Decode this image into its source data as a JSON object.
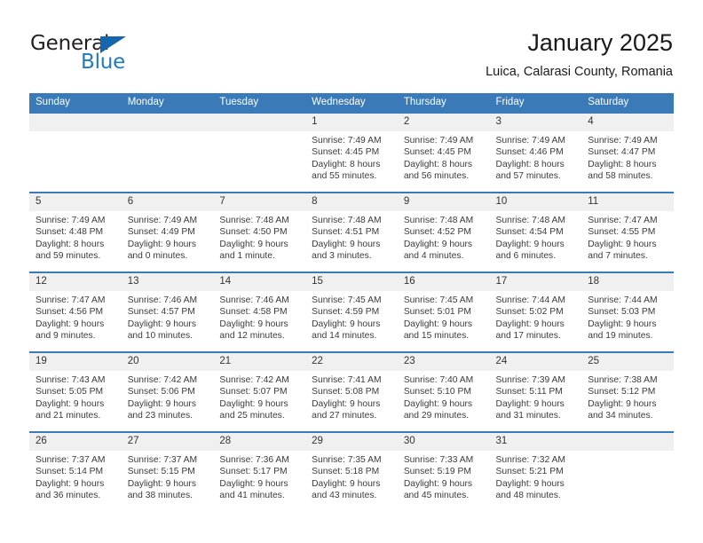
{
  "brand": {
    "name_part1": "General",
    "name_part2": "Blue",
    "triangle_color": "#1566ad",
    "blue_color": "#1f7bc1"
  },
  "header": {
    "title": "January 2025",
    "subtitle": "Luica, Calarasi County, Romania"
  },
  "theme": {
    "header_blue": "#3a7ab8",
    "daynum_bg": "#f0f0f0"
  },
  "weekday_headers": [
    "Sunday",
    "Monday",
    "Tuesday",
    "Wednesday",
    "Thursday",
    "Friday",
    "Saturday"
  ],
  "weeks": [
    [
      {
        "day": "",
        "blank": true,
        "sunrise": "",
        "sunset": "",
        "daylight": ""
      },
      {
        "day": "",
        "blank": true,
        "sunrise": "",
        "sunset": "",
        "daylight": ""
      },
      {
        "day": "",
        "blank": true,
        "sunrise": "",
        "sunset": "",
        "daylight": ""
      },
      {
        "day": "1",
        "blank": false,
        "sunrise": "Sunrise: 7:49 AM",
        "sunset": "Sunset: 4:45 PM",
        "daylight": "Daylight: 8 hours and 55 minutes."
      },
      {
        "day": "2",
        "blank": false,
        "sunrise": "Sunrise: 7:49 AM",
        "sunset": "Sunset: 4:45 PM",
        "daylight": "Daylight: 8 hours and 56 minutes."
      },
      {
        "day": "3",
        "blank": false,
        "sunrise": "Sunrise: 7:49 AM",
        "sunset": "Sunset: 4:46 PM",
        "daylight": "Daylight: 8 hours and 57 minutes."
      },
      {
        "day": "4",
        "blank": false,
        "sunrise": "Sunrise: 7:49 AM",
        "sunset": "Sunset: 4:47 PM",
        "daylight": "Daylight: 8 hours and 58 minutes."
      }
    ],
    [
      {
        "day": "5",
        "blank": false,
        "sunrise": "Sunrise: 7:49 AM",
        "sunset": "Sunset: 4:48 PM",
        "daylight": "Daylight: 8 hours and 59 minutes."
      },
      {
        "day": "6",
        "blank": false,
        "sunrise": "Sunrise: 7:49 AM",
        "sunset": "Sunset: 4:49 PM",
        "daylight": "Daylight: 9 hours and 0 minutes."
      },
      {
        "day": "7",
        "blank": false,
        "sunrise": "Sunrise: 7:48 AM",
        "sunset": "Sunset: 4:50 PM",
        "daylight": "Daylight: 9 hours and 1 minute."
      },
      {
        "day": "8",
        "blank": false,
        "sunrise": "Sunrise: 7:48 AM",
        "sunset": "Sunset: 4:51 PM",
        "daylight": "Daylight: 9 hours and 3 minutes."
      },
      {
        "day": "9",
        "blank": false,
        "sunrise": "Sunrise: 7:48 AM",
        "sunset": "Sunset: 4:52 PM",
        "daylight": "Daylight: 9 hours and 4 minutes."
      },
      {
        "day": "10",
        "blank": false,
        "sunrise": "Sunrise: 7:48 AM",
        "sunset": "Sunset: 4:54 PM",
        "daylight": "Daylight: 9 hours and 6 minutes."
      },
      {
        "day": "11",
        "blank": false,
        "sunrise": "Sunrise: 7:47 AM",
        "sunset": "Sunset: 4:55 PM",
        "daylight": "Daylight: 9 hours and 7 minutes."
      }
    ],
    [
      {
        "day": "12",
        "blank": false,
        "sunrise": "Sunrise: 7:47 AM",
        "sunset": "Sunset: 4:56 PM",
        "daylight": "Daylight: 9 hours and 9 minutes."
      },
      {
        "day": "13",
        "blank": false,
        "sunrise": "Sunrise: 7:46 AM",
        "sunset": "Sunset: 4:57 PM",
        "daylight": "Daylight: 9 hours and 10 minutes."
      },
      {
        "day": "14",
        "blank": false,
        "sunrise": "Sunrise: 7:46 AM",
        "sunset": "Sunset: 4:58 PM",
        "daylight": "Daylight: 9 hours and 12 minutes."
      },
      {
        "day": "15",
        "blank": false,
        "sunrise": "Sunrise: 7:45 AM",
        "sunset": "Sunset: 4:59 PM",
        "daylight": "Daylight: 9 hours and 14 minutes."
      },
      {
        "day": "16",
        "blank": false,
        "sunrise": "Sunrise: 7:45 AM",
        "sunset": "Sunset: 5:01 PM",
        "daylight": "Daylight: 9 hours and 15 minutes."
      },
      {
        "day": "17",
        "blank": false,
        "sunrise": "Sunrise: 7:44 AM",
        "sunset": "Sunset: 5:02 PM",
        "daylight": "Daylight: 9 hours and 17 minutes."
      },
      {
        "day": "18",
        "blank": false,
        "sunrise": "Sunrise: 7:44 AM",
        "sunset": "Sunset: 5:03 PM",
        "daylight": "Daylight: 9 hours and 19 minutes."
      }
    ],
    [
      {
        "day": "19",
        "blank": false,
        "sunrise": "Sunrise: 7:43 AM",
        "sunset": "Sunset: 5:05 PM",
        "daylight": "Daylight: 9 hours and 21 minutes."
      },
      {
        "day": "20",
        "blank": false,
        "sunrise": "Sunrise: 7:42 AM",
        "sunset": "Sunset: 5:06 PM",
        "daylight": "Daylight: 9 hours and 23 minutes."
      },
      {
        "day": "21",
        "blank": false,
        "sunrise": "Sunrise: 7:42 AM",
        "sunset": "Sunset: 5:07 PM",
        "daylight": "Daylight: 9 hours and 25 minutes."
      },
      {
        "day": "22",
        "blank": false,
        "sunrise": "Sunrise: 7:41 AM",
        "sunset": "Sunset: 5:08 PM",
        "daylight": "Daylight: 9 hours and 27 minutes."
      },
      {
        "day": "23",
        "blank": false,
        "sunrise": "Sunrise: 7:40 AM",
        "sunset": "Sunset: 5:10 PM",
        "daylight": "Daylight: 9 hours and 29 minutes."
      },
      {
        "day": "24",
        "blank": false,
        "sunrise": "Sunrise: 7:39 AM",
        "sunset": "Sunset: 5:11 PM",
        "daylight": "Daylight: 9 hours and 31 minutes."
      },
      {
        "day": "25",
        "blank": false,
        "sunrise": "Sunrise: 7:38 AM",
        "sunset": "Sunset: 5:12 PM",
        "daylight": "Daylight: 9 hours and 34 minutes."
      }
    ],
    [
      {
        "day": "26",
        "blank": false,
        "sunrise": "Sunrise: 7:37 AM",
        "sunset": "Sunset: 5:14 PM",
        "daylight": "Daylight: 9 hours and 36 minutes."
      },
      {
        "day": "27",
        "blank": false,
        "sunrise": "Sunrise: 7:37 AM",
        "sunset": "Sunset: 5:15 PM",
        "daylight": "Daylight: 9 hours and 38 minutes."
      },
      {
        "day": "28",
        "blank": false,
        "sunrise": "Sunrise: 7:36 AM",
        "sunset": "Sunset: 5:17 PM",
        "daylight": "Daylight: 9 hours and 41 minutes."
      },
      {
        "day": "29",
        "blank": false,
        "sunrise": "Sunrise: 7:35 AM",
        "sunset": "Sunset: 5:18 PM",
        "daylight": "Daylight: 9 hours and 43 minutes."
      },
      {
        "day": "30",
        "blank": false,
        "sunrise": "Sunrise: 7:33 AM",
        "sunset": "Sunset: 5:19 PM",
        "daylight": "Daylight: 9 hours and 45 minutes."
      },
      {
        "day": "31",
        "blank": false,
        "sunrise": "Sunrise: 7:32 AM",
        "sunset": "Sunset: 5:21 PM",
        "daylight": "Daylight: 9 hours and 48 minutes."
      },
      {
        "day": "",
        "blank": true,
        "sunrise": "",
        "sunset": "",
        "daylight": ""
      }
    ]
  ]
}
